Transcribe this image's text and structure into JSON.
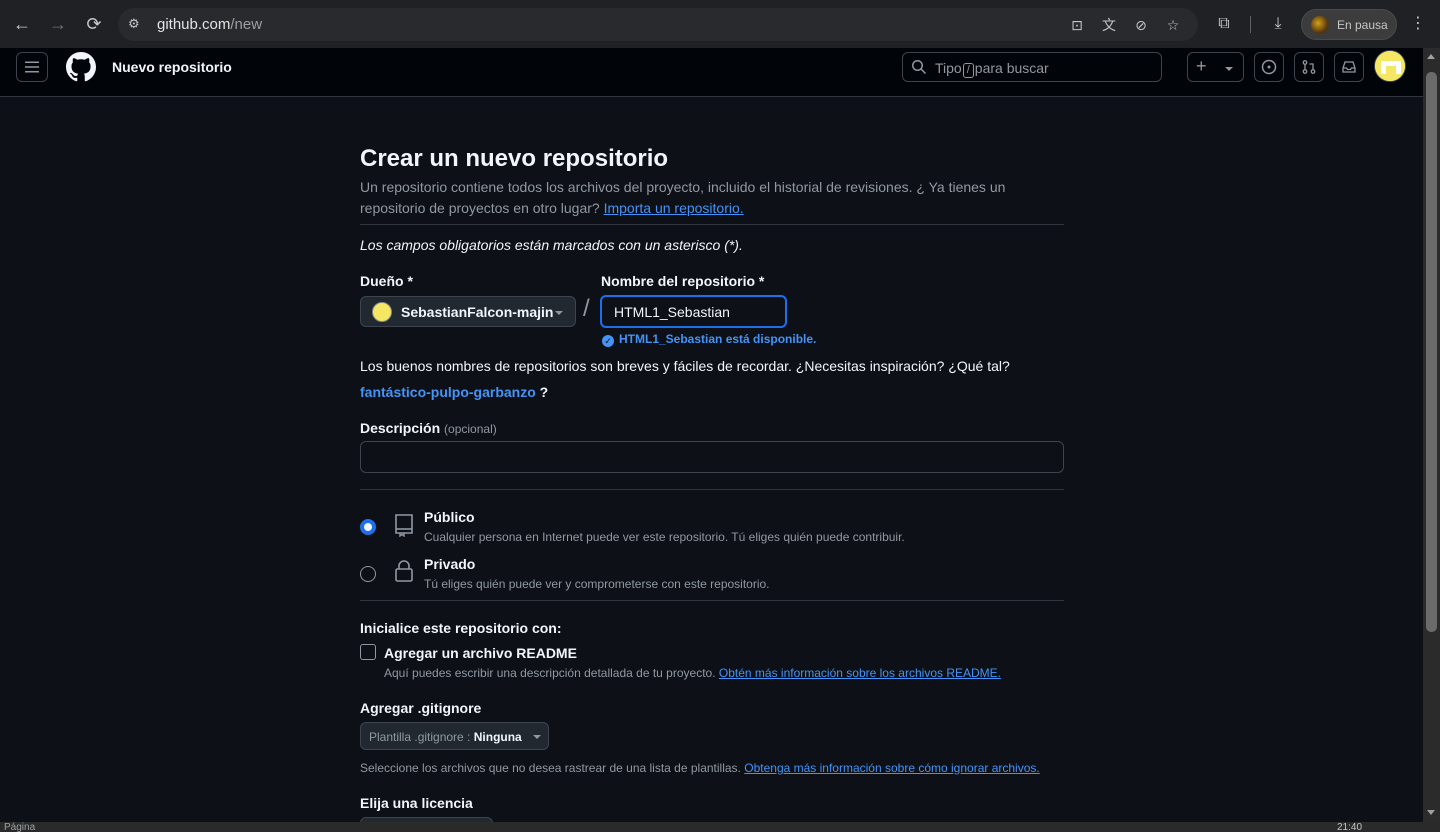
{
  "browser": {
    "url_host": "github.com",
    "url_path": "/new",
    "profile_status": "En pausa",
    "status_text": "Página",
    "clock": "21:40"
  },
  "header": {
    "title": "Nuevo repositorio",
    "search_before": "Tipo",
    "search_key": "/",
    "search_after": "para buscar"
  },
  "form": {
    "heading": "Crear un nuevo repositorio",
    "intro_text": "Un repositorio contiene todos los archivos del proyecto, incluido el historial de revisiones. ¿ Ya tienes un repositorio de proyectos en otro lugar?",
    "import_link": "Importa un repositorio.",
    "required_note": "Los campos obligatorios están marcados con un asterisco (*).",
    "owner_label": "Dueño *",
    "owner_value": "SebastianFalcon-majin",
    "separator": "/",
    "name_label": "Nombre del repositorio *",
    "name_value": "HTML1_Sebastian",
    "availability": "HTML1_Sebastian está disponible.",
    "name_hint": "Los buenos nombres de repositorios son breves y fáciles de recordar. ¿Necesitas inspiración? ¿Qué tal?",
    "suggestion": "fantástico-pulpo-garbanzo",
    "suggestion_suffix": "?",
    "description_label": "Descripción",
    "description_optional": "(opcional)",
    "description_value": "",
    "visibility": {
      "selected": "public",
      "public_title": "Público",
      "public_desc": "Cualquier persona en Internet puede ver este repositorio. Tú eliges quién puede contribuir.",
      "private_title": "Privado",
      "private_desc": "Tú eliges quién puede ver y comprometerse con este repositorio."
    },
    "init_label": "Inicialice este repositorio con:",
    "readme_label": "Agregar un archivo README",
    "readme_checked": false,
    "readme_desc": "Aquí puedes escribir una descripción detallada de tu proyecto.",
    "readme_link": "Obtén más información sobre los archivos README.",
    "gitignore_label": "Agregar .gitignore",
    "gitignore_prefix": "Plantilla .gitignore :",
    "gitignore_value": "Ninguna",
    "gitignore_desc": "Seleccione los archivos que no desea rastrear de una lista de plantillas.",
    "gitignore_link": "Obtenga más información sobre cómo ignorar archivos.",
    "license_label": "Elija una licencia"
  },
  "colors": {
    "accent_blue": "#4493f8",
    "focus_blue": "#1f6feb",
    "bg": "#0d1117",
    "header_bg": "#010409"
  }
}
